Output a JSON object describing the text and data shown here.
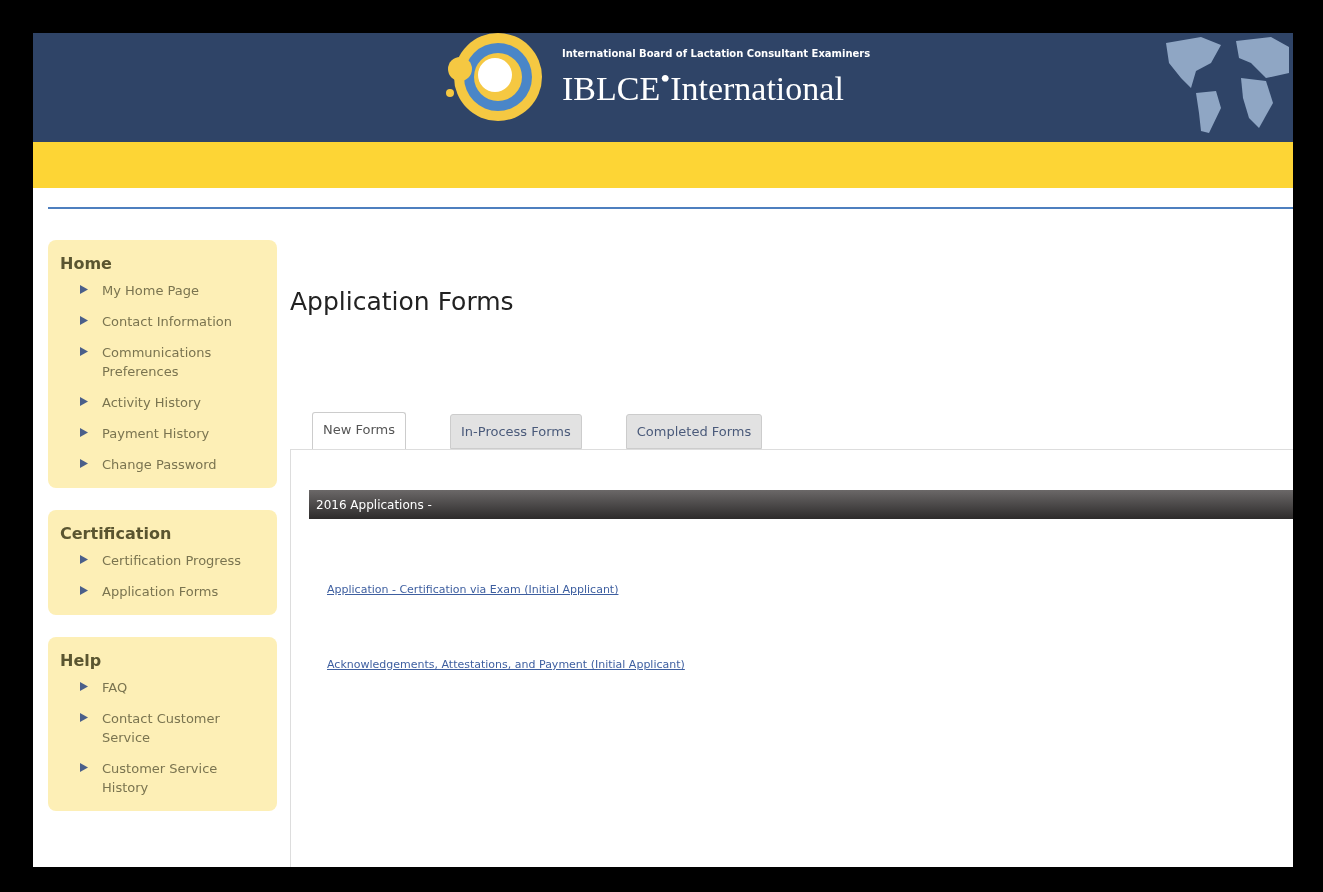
{
  "header": {
    "subtitle": "International Board of Lactation Consultant Examiners",
    "title": "IBLCE$^{•}$International"
  },
  "sidebar": [
    {
      "title": "Home",
      "items": [
        {
          "label": "My Home Page",
          "selected": false
        },
        {
          "label": "Contact Information",
          "selected": false
        },
        {
          "label": "Communications Preferences",
          "selected": false
        },
        {
          "label": "Activity History",
          "selected": false
        },
        {
          "label": "Payment History",
          "selected": false
        },
        {
          "label": "Change Password",
          "selected": false
        }
      ]
    },
    {
      "title": "Certification",
      "items": [
        {
          "label": "Certification Progress",
          "selected": false
        },
        {
          "label": "Application Forms",
          "selected": false
        }
      ]
    },
    {
      "title": "Help",
      "items": [
        {
          "label": "FAQ",
          "selected": false
        },
        {
          "label": "Contact Customer Service",
          "selected": false
        },
        {
          "label": "Customer Service History",
          "selected": false
        }
      ]
    }
  ],
  "page_title": "Application Forms",
  "tabs": [
    {
      "label": "New Forms",
      "selected": true
    },
    {
      "label": "In-Process Forms",
      "selected": false
    },
    {
      "label": "Completed Forms",
      "selected": false
    }
  ],
  "section": {
    "title": "2016 Applications -",
    "links": [
      "Application - Certification via Exam (Initial Applicant)",
      "Acknowledgements, Attestations, and Payment (Initial Applicant)"
    ]
  }
}
